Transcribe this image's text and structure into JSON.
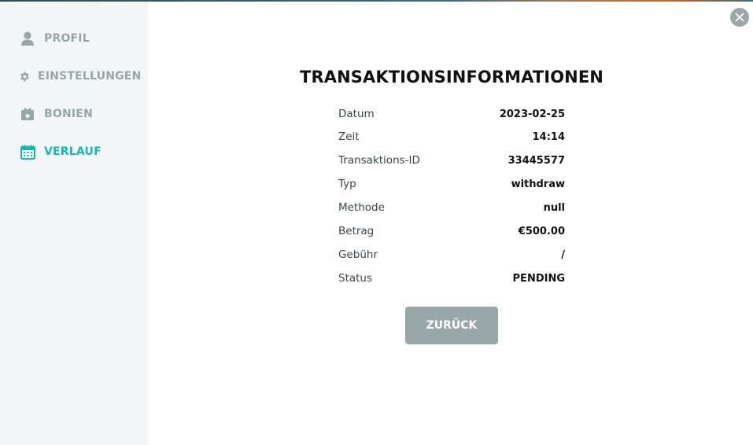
{
  "sidebar": {
    "items": [
      {
        "label": "PROFIL",
        "icon": "user-icon",
        "active": false
      },
      {
        "label": "EINSTELLUNGEN",
        "icon": "gear-icon",
        "active": false
      },
      {
        "label": "BONIEN",
        "icon": "gift-icon",
        "active": false
      },
      {
        "label": "VERLAUF",
        "icon": "calendar-icon",
        "active": true
      }
    ]
  },
  "modal": {
    "title": "TRANSAKTIONSINFORMATIONEN",
    "rows": [
      {
        "key": "Datum",
        "value": "2023-02-25"
      },
      {
        "key": "Zeit",
        "value": "14:14"
      },
      {
        "key": "Transaktions-ID",
        "value": "33445577"
      },
      {
        "key": "Typ",
        "value": "withdraw"
      },
      {
        "key": "Methode",
        "value": "null"
      },
      {
        "key": "Betrag",
        "value": "€500.00"
      },
      {
        "key": "Gebühr",
        "value": "/"
      },
      {
        "key": "Status",
        "value": "PENDING"
      }
    ],
    "back_label": "ZURÜCK",
    "close_icon": "close-icon"
  },
  "colors": {
    "accent": "#1ab5b3",
    "nav_inactive": "#98a6a8",
    "sidebar_bg": "#f2f6f7",
    "button_bg": "#98a8a9"
  }
}
